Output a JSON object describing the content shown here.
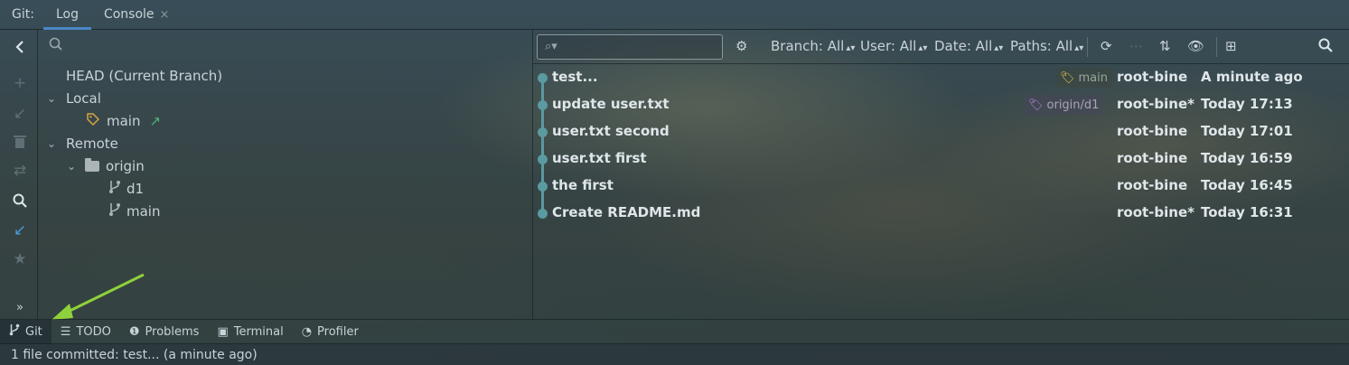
{
  "topbar": {
    "prefix": "Git:",
    "tabs": [
      {
        "label": "Log",
        "active": true
      },
      {
        "label": "Console",
        "closable": true
      }
    ],
    "close_glyph": "×"
  },
  "left_tools": [
    {
      "icon": "back-chevron-icon",
      "glyph": "‹"
    },
    {
      "icon": "add-icon",
      "glyph": "+"
    },
    {
      "icon": "checkout-icon",
      "glyph": "↙"
    },
    {
      "icon": "delete-icon",
      "glyph": "🗑"
    },
    {
      "icon": "compare-icon",
      "glyph": "⇄"
    },
    {
      "icon": "search-icon",
      "glyph": "⌕"
    },
    {
      "icon": "update-icon",
      "glyph": "↙"
    },
    {
      "icon": "star-icon",
      "glyph": "★"
    },
    {
      "icon": "expand-icon",
      "glyph": "»"
    }
  ],
  "tree": {
    "search_icon": "⌕",
    "head": "HEAD (Current Branch)",
    "local_label": "Local",
    "local_branches": [
      {
        "name": "main"
      }
    ],
    "remote_label": "Remote",
    "remote_name": "origin",
    "remote_branches": [
      {
        "name": "d1"
      },
      {
        "name": "main"
      }
    ]
  },
  "log_toolbar": {
    "search_glyph": "⌕▾",
    "branch": "Branch: All",
    "user": "User: All",
    "date": "Date: All",
    "paths": "Paths: All",
    "caret": "▴▾"
  },
  "commits": [
    {
      "message": "test...",
      "ref": "main",
      "author": "root-bine",
      "date": "A minute ago"
    },
    {
      "message": "update user.txt",
      "ref": "origin/d1",
      "author": "root-bine*",
      "date": "Today 17:13"
    },
    {
      "message": "user.txt second",
      "ref": "",
      "author": "root-bine",
      "date": "Today 17:01"
    },
    {
      "message": "user.txt first",
      "ref": "",
      "author": "root-bine",
      "date": "Today 16:59"
    },
    {
      "message": "the first",
      "ref": "",
      "author": "root-bine",
      "date": "Today 16:45"
    },
    {
      "message": "Create README.md",
      "ref": "",
      "author": "root-bine*",
      "date": "Today 16:31"
    }
  ],
  "tool_windows": [
    {
      "label": "Git",
      "icon": "git-branch-icon",
      "active": true
    },
    {
      "label": "TODO",
      "icon": "list-icon"
    },
    {
      "label": "Problems",
      "icon": "warning-icon"
    },
    {
      "label": "Terminal",
      "icon": "terminal-icon"
    },
    {
      "label": "Profiler",
      "icon": "profiler-icon"
    }
  ],
  "status": "1 file committed: test... (a minute ago)",
  "colors": {
    "accent": "#4a86c5",
    "graph": "#5a9aa0",
    "tag_main": "#e2c042",
    "tag_origin": "#b084d6",
    "arrow": "#8fd13a"
  }
}
